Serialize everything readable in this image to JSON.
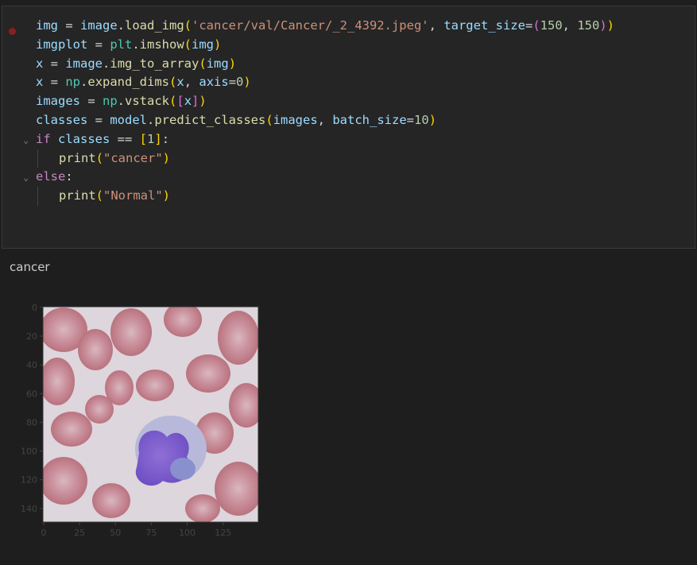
{
  "code_cell": {
    "lines": [
      {
        "tokens": [
          {
            "t": "img",
            "c": "v"
          },
          {
            "t": " = ",
            "c": ""
          },
          {
            "t": "image",
            "c": "v"
          },
          {
            "t": ".",
            "c": ""
          },
          {
            "t": "load_img",
            "c": "f"
          },
          {
            "t": "(",
            "c": "p1"
          },
          {
            "t": "'cancer/val/Cancer/_2_4392.jpeg'",
            "c": "s"
          },
          {
            "t": ", ",
            "c": ""
          },
          {
            "t": "target_size",
            "c": "v"
          },
          {
            "t": "=",
            "c": ""
          },
          {
            "t": "(",
            "c": "p2"
          },
          {
            "t": "150",
            "c": "n"
          },
          {
            "t": ", ",
            "c": ""
          },
          {
            "t": "150",
            "c": "n"
          },
          {
            "t": ")",
            "c": "p2"
          },
          {
            "t": ")",
            "c": "p1"
          }
        ]
      },
      {
        "tokens": [
          {
            "t": "imgplot",
            "c": "v"
          },
          {
            "t": " = ",
            "c": ""
          },
          {
            "t": "plt",
            "c": "t"
          },
          {
            "t": ".",
            "c": ""
          },
          {
            "t": "imshow",
            "c": "f"
          },
          {
            "t": "(",
            "c": "p1"
          },
          {
            "t": "img",
            "c": "v"
          },
          {
            "t": ")",
            "c": "p1"
          }
        ]
      },
      {
        "tokens": [
          {
            "t": "x",
            "c": "v"
          },
          {
            "t": " = ",
            "c": ""
          },
          {
            "t": "image",
            "c": "v"
          },
          {
            "t": ".",
            "c": ""
          },
          {
            "t": "img_to_array",
            "c": "f"
          },
          {
            "t": "(",
            "c": "p1"
          },
          {
            "t": "img",
            "c": "v"
          },
          {
            "t": ")",
            "c": "p1"
          }
        ]
      },
      {
        "tokens": [
          {
            "t": "x",
            "c": "v"
          },
          {
            "t": " = ",
            "c": ""
          },
          {
            "t": "np",
            "c": "t"
          },
          {
            "t": ".",
            "c": ""
          },
          {
            "t": "expand_dims",
            "c": "f"
          },
          {
            "t": "(",
            "c": "p1"
          },
          {
            "t": "x",
            "c": "v"
          },
          {
            "t": ", ",
            "c": ""
          },
          {
            "t": "axis",
            "c": "v"
          },
          {
            "t": "=",
            "c": ""
          },
          {
            "t": "0",
            "c": "n"
          },
          {
            "t": ")",
            "c": "p1"
          }
        ]
      },
      {
        "tokens": [
          {
            "t": "images",
            "c": "v"
          },
          {
            "t": " = ",
            "c": ""
          },
          {
            "t": "np",
            "c": "t"
          },
          {
            "t": ".",
            "c": ""
          },
          {
            "t": "vstack",
            "c": "f"
          },
          {
            "t": "(",
            "c": "p1"
          },
          {
            "t": "[",
            "c": "p2"
          },
          {
            "t": "x",
            "c": "v"
          },
          {
            "t": "]",
            "c": "p2"
          },
          {
            "t": ")",
            "c": "p1"
          }
        ]
      },
      {
        "tokens": [
          {
            "t": "classes",
            "c": "v"
          },
          {
            "t": " = ",
            "c": ""
          },
          {
            "t": "model",
            "c": "v"
          },
          {
            "t": ".",
            "c": ""
          },
          {
            "t": "predict_classes",
            "c": "f"
          },
          {
            "t": "(",
            "c": "p1"
          },
          {
            "t": "images",
            "c": "v"
          },
          {
            "t": ", ",
            "c": ""
          },
          {
            "t": "batch_size",
            "c": "v"
          },
          {
            "t": "=",
            "c": ""
          },
          {
            "t": "10",
            "c": "n"
          },
          {
            "t": ")",
            "c": "p1"
          }
        ]
      },
      {
        "fold": true,
        "tokens": [
          {
            "t": "if",
            "c": "k"
          },
          {
            "t": " ",
            "c": ""
          },
          {
            "t": "classes",
            "c": "v"
          },
          {
            "t": " == ",
            "c": ""
          },
          {
            "t": "[",
            "c": "p1"
          },
          {
            "t": "1",
            "c": "n"
          },
          {
            "t": "]",
            "c": "p1"
          },
          {
            "t": ":",
            "c": ""
          }
        ]
      },
      {
        "indent": true,
        "tokens": [
          {
            "t": "print",
            "c": "f"
          },
          {
            "t": "(",
            "c": "p1"
          },
          {
            "t": "\"cancer\"",
            "c": "s"
          },
          {
            "t": ")",
            "c": "p1"
          }
        ]
      },
      {
        "fold": true,
        "tokens": [
          {
            "t": "else",
            "c": "k"
          },
          {
            "t": ":",
            "c": ""
          }
        ]
      },
      {
        "indent": true,
        "tokens": [
          {
            "t": "print",
            "c": "f"
          },
          {
            "t": "(",
            "c": "p1"
          },
          {
            "t": "\"Normal\"",
            "c": "s"
          },
          {
            "t": ")",
            "c": "p1"
          }
        ]
      }
    ]
  },
  "output": {
    "text": "cancer"
  },
  "plot": {
    "y_ticks": [
      "0",
      "20",
      "40",
      "60",
      "80",
      "100",
      "120",
      "140"
    ],
    "x_ticks": [
      "0",
      "25",
      "50",
      "75",
      "100",
      "125"
    ],
    "image_description_icon": "blood-smear-image"
  },
  "colors": {
    "background": "#1e1e1e",
    "cell": "#252526",
    "breakpoint": "#8a1f1f"
  }
}
